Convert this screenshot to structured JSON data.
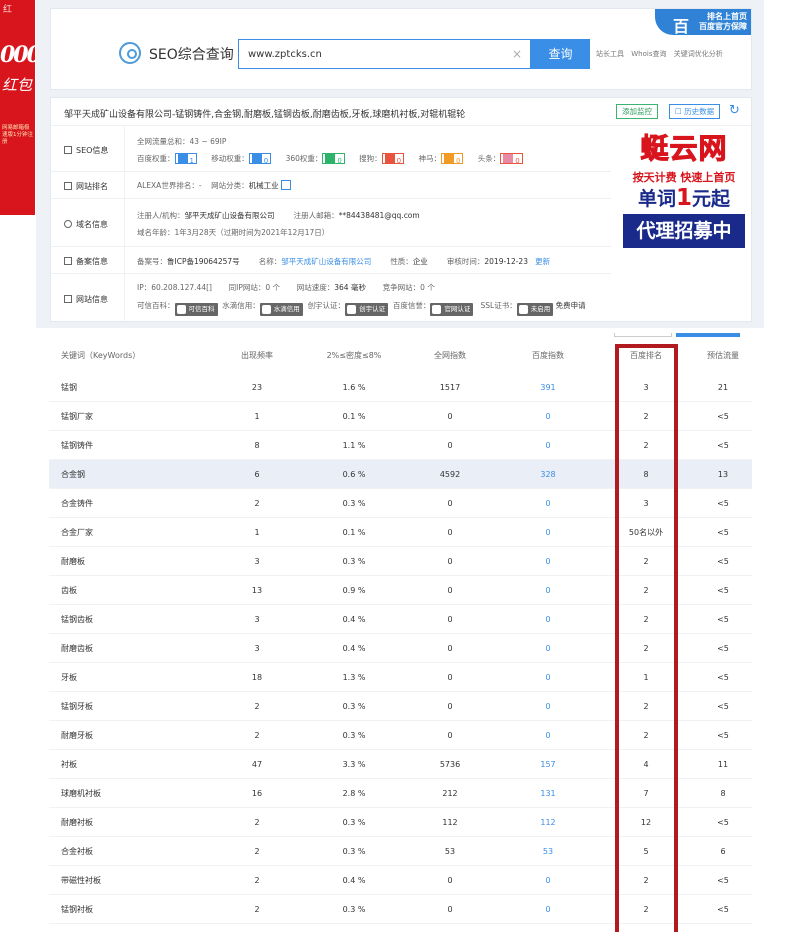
{
  "left_ad": {
    "top": "红",
    "big": "000",
    "script": "红包",
    "small": "网易邮箱极速版1分钟注册"
  },
  "badge": {
    "icon": "百",
    "line1": "排名上首页",
    "line2": "百度官方保障"
  },
  "search": {
    "title": "SEO综合查询",
    "value": "www.zptcks.cn",
    "clear": "×",
    "button": "查询",
    "links": [
      "站长工具",
      "Whois查询",
      "关键词优化分析"
    ]
  },
  "company": {
    "title": "邹平天成矿山设备有限公司-锰钢铸件,合金钢,耐磨板,锰钢齿板,耐磨齿板,牙板,球磨机衬板,对辊机辊轮",
    "monitor_btn": "添加监控",
    "history_btn": "历史数据",
    "refresh": "↻"
  },
  "seo": {
    "label": "SEO信息",
    "traffic": "全网流量总和：43 ~ 69IP",
    "baidu_label": "百度权重：",
    "baidu_value": "1",
    "mobile_label": "移动权重：",
    "mobile_value": "0",
    "s360_label": "360权重：",
    "s360_value": "0",
    "sogou_label": "搜狗：",
    "sogou_value": "0",
    "shenma_label": "神马：",
    "shenma_value": "0",
    "toutiao_label": "头条：",
    "toutiao_value": "0"
  },
  "rank": {
    "label": "网站排名",
    "alexa": "ALEXA世界排名：-",
    "category_label": "网站分类：",
    "category": "机械工业"
  },
  "domain": {
    "label": "域名信息",
    "registrant_label": "注册人/机构：",
    "registrant": "邹平天成矿山设备有限公司",
    "email_label": "注册人邮箱：",
    "email": "**84438481@qq.com",
    "age": "域名年龄：1年3月28天（过期时间为2021年12月17日）"
  },
  "icp": {
    "label": "备案信息",
    "no_label": "备案号：",
    "no": "鲁ICP备19064257号",
    "name_label": "名称：",
    "name": "邹平天成矿山设备有限公司",
    "nature_label": "性质：",
    "nature": "企业",
    "date_label": "审核时间：",
    "date": "2019-12-23",
    "update": "更新"
  },
  "site": {
    "label": "网站信息",
    "ip": "IP：60.208.127.44[]",
    "same_ip": "同IP网站：0 个",
    "speed_label": "网站速度：",
    "speed": "364 毫秒",
    "compete": "竞争网站：0 个",
    "trust_label": "可信百科：",
    "trust_badge": "可信百科",
    "water_label": "水滴信用：",
    "water_badge": "水滴信用",
    "chuangyu_label": "创宇认证：",
    "chuangyu_badge": "创宇认证",
    "baidu_credit_label": "百度信誉：",
    "baidu_credit_badge": "官网认证",
    "ssl_label": "SSL证书：",
    "ssl_badge": "未启用",
    "ssl_free": "免费申请"
  },
  "right_ad": {
    "brand": "蜓云网",
    "slogan": "按天计费 快速上首页",
    "price_pre": "单词",
    "price_num": "1",
    "price_post": "元起",
    "recruit": "代理招募中"
  },
  "table": {
    "headers": [
      "关键词（KeyWords）",
      "出现频率",
      "2%≤密度≤8%",
      "全网指数",
      "百度指数",
      "百度排名",
      "预估流量"
    ],
    "rows": [
      [
        "锰钢",
        "23",
        "1.6 %",
        "1517",
        "391",
        "3",
        "21"
      ],
      [
        "锰钢厂家",
        "1",
        "0.1 %",
        "0",
        "0",
        "2",
        "<5"
      ],
      [
        "锰钢铸件",
        "8",
        "1.1 %",
        "0",
        "0",
        "2",
        "<5"
      ],
      [
        "合金钢",
        "6",
        "0.6 %",
        "4592",
        "328",
        "8",
        "13"
      ],
      [
        "合金铸件",
        "2",
        "0.3 %",
        "0",
        "0",
        "3",
        "<5"
      ],
      [
        "合金厂家",
        "1",
        "0.1 %",
        "0",
        "0",
        "50名以外",
        "<5"
      ],
      [
        "耐磨板",
        "3",
        "0.3 %",
        "0",
        "0",
        "2",
        "<5"
      ],
      [
        "齿板",
        "13",
        "0.9 %",
        "0",
        "0",
        "2",
        "<5"
      ],
      [
        "锰钢齿板",
        "3",
        "0.4 %",
        "0",
        "0",
        "2",
        "<5"
      ],
      [
        "耐磨齿板",
        "3",
        "0.4 %",
        "0",
        "0",
        "2",
        "<5"
      ],
      [
        "牙板",
        "18",
        "1.3 %",
        "0",
        "0",
        "1",
        "<5"
      ],
      [
        "锰钢牙板",
        "2",
        "0.3 %",
        "0",
        "0",
        "2",
        "<5"
      ],
      [
        "耐磨牙板",
        "2",
        "0.3 %",
        "0",
        "0",
        "2",
        "<5"
      ],
      [
        "衬板",
        "47",
        "3.3 %",
        "5736",
        "157",
        "4",
        "11"
      ],
      [
        "球磨机衬板",
        "16",
        "2.8 %",
        "212",
        "131",
        "7",
        "8"
      ],
      [
        "耐磨衬板",
        "2",
        "0.3 %",
        "112",
        "112",
        "12",
        "<5"
      ],
      [
        "合金衬板",
        "2",
        "0.3 %",
        "53",
        "53",
        "5",
        "6"
      ],
      [
        "带磁性衬板",
        "2",
        "0.4 %",
        "0",
        "0",
        "2",
        "<5"
      ],
      [
        "锰钢衬板",
        "2",
        "0.3 %",
        "0",
        "0",
        "2",
        "<5"
      ]
    ]
  },
  "colors": {
    "accent": "#3a8ee6",
    "highlight_frame": "#b11a1f",
    "left_ad": "#d8141d",
    "row_highlight": "#e9eef7"
  }
}
